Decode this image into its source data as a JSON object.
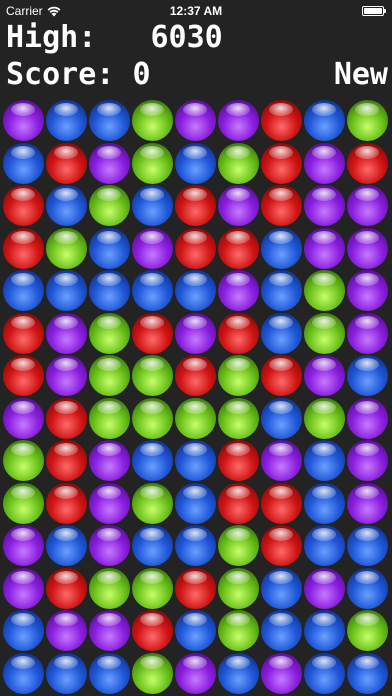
{
  "status_bar": {
    "carrier": "Carrier",
    "time": "12:37 AM"
  },
  "header": {
    "high_label": "High:",
    "high_value": "6030",
    "score_label": "Score:",
    "score_value": "0",
    "new_button": "New"
  },
  "colors": {
    "background": "#232323",
    "purple": "#8a1ee0",
    "blue": "#1f57d8",
    "red": "#d01414",
    "green": "#6bc21a"
  },
  "board": {
    "columns": 9,
    "rows": 14,
    "cells": [
      [
        "purple",
        "blue",
        "blue",
        "green",
        "purple",
        "purple",
        "red",
        "blue",
        "green"
      ],
      [
        "blue",
        "red",
        "purple",
        "green",
        "blue",
        "green",
        "red",
        "purple",
        "red"
      ],
      [
        "red",
        "blue",
        "green",
        "blue",
        "red",
        "purple",
        "red",
        "purple",
        "purple"
      ],
      [
        "red",
        "green",
        "blue",
        "purple",
        "red",
        "red",
        "blue",
        "purple",
        "purple"
      ],
      [
        "blue",
        "blue",
        "blue",
        "blue",
        "blue",
        "purple",
        "blue",
        "green",
        "purple"
      ],
      [
        "red",
        "purple",
        "green",
        "red",
        "purple",
        "red",
        "blue",
        "green",
        "purple"
      ],
      [
        "red",
        "purple",
        "green",
        "green",
        "red",
        "green",
        "red",
        "purple",
        "blue"
      ],
      [
        "purple",
        "red",
        "green",
        "green",
        "green",
        "green",
        "blue",
        "green",
        "purple"
      ],
      [
        "green",
        "red",
        "purple",
        "blue",
        "blue",
        "red",
        "purple",
        "blue",
        "purple"
      ],
      [
        "green",
        "red",
        "purple",
        "green",
        "blue",
        "red",
        "red",
        "blue",
        "purple"
      ],
      [
        "purple",
        "blue",
        "purple",
        "blue",
        "blue",
        "green",
        "red",
        "blue",
        "blue"
      ],
      [
        "purple",
        "red",
        "green",
        "green",
        "red",
        "green",
        "blue",
        "purple",
        "blue"
      ],
      [
        "blue",
        "purple",
        "purple",
        "red",
        "blue",
        "green",
        "blue",
        "blue",
        "green"
      ],
      [
        "blue",
        "blue",
        "blue",
        "green",
        "purple",
        "blue",
        "purple",
        "blue",
        "blue"
      ]
    ]
  }
}
